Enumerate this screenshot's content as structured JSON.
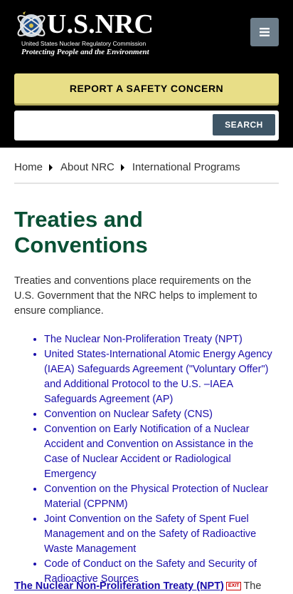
{
  "header": {
    "logo_title": "U.S.NRC",
    "logo_subtitle": "United States Nuclear Regulatory Commission",
    "logo_tagline": "Protecting People and the Environment",
    "report_label": "REPORT A SAFETY CONCERN",
    "search_placeholder": "",
    "search_button": "SEARCH",
    "menu_icon": "hamburger-icon"
  },
  "breadcrumb": {
    "items": [
      "Home",
      "About NRC",
      "International Programs"
    ]
  },
  "page": {
    "title": "Treaties and Conventions",
    "intro": "Treaties and conventions place requirements on the U.S. Government that the NRC helps to implement to ensure compliance.",
    "links": [
      "The Nuclear Non-Proliferation Treaty (NPT)",
      "United States-International Atomic Energy Agency (IAEA) Safeguards Agreement (\"Voluntary Offer\") and Additional Protocol to the U.S. –IAEA Safeguards Agreement (AP)",
      "Convention on Nuclear Safety (CNS)",
      "Convention on Early Notification of a Nuclear Accident and Convention on Assistance in the Case of Nuclear Accident or Radiological Emergency",
      "Convention on the Physical Protection of Nuclear Material (CPPNM)",
      "Joint Convention on the Safety of Spent Fuel Management and on the Safety of Radioactive Waste Management",
      "Code of Conduct on the Safety and Security of Radioactive Sources"
    ],
    "bottom_link": "The Nuclear Non-Proliferation Treaty (NPT)",
    "bottom_badge": "EXIT",
    "bottom_text": "The"
  },
  "colors": {
    "header_bg": "#000000",
    "report_bg": "#e8de87",
    "search_btn_bg": "#3e5566",
    "title_color": "#0a5035",
    "link_color": "#1a0dab"
  }
}
